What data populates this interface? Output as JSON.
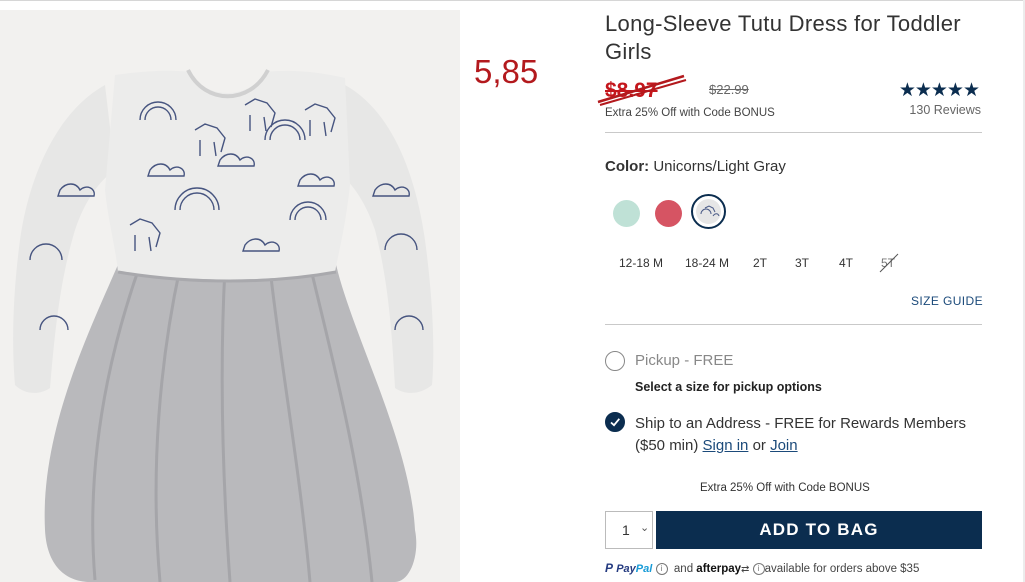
{
  "overlay": {
    "price_annotation": "5,85"
  },
  "product": {
    "title": "Long-Sleeve Tutu Dress for Toddler Girls",
    "sale_price": "$8.97",
    "original_price": "$22.99",
    "promo": "Extra 25% Off with Code BONUS",
    "rating_stars": "★★★★★",
    "rating_value": 5,
    "reviews": "130 Reviews",
    "image_icon": "dress-photo"
  },
  "color": {
    "label": "Color:",
    "selected": "Unicorns/Light Gray",
    "swatches": [
      {
        "name": "mint",
        "color": "#bfe1d6"
      },
      {
        "name": "coral-red",
        "color": "#d65463"
      },
      {
        "name": "unicorns-light-gray",
        "color": "#e6e6e6",
        "selected": true
      }
    ]
  },
  "sizes": [
    "12-18 M",
    "18-24 M",
    "2T",
    "3T",
    "4T",
    "5T"
  ],
  "unavailable_size": "5T",
  "size_guide": "SIZE GUIDE",
  "fulfillment": {
    "pickup_label": "Pickup - FREE",
    "pickup_sub": "Select a size for pickup options",
    "ship_label": "Ship to an Address - FREE for Rewards Members ($50 min)",
    "sign_in": "Sign in",
    "or": "or",
    "join": "Join"
  },
  "promo_bottom": "Extra 25% Off with Code BONUS",
  "quantity": "1",
  "add_to_bag": "ADD TO BAG",
  "payment": {
    "paypal_p": "P",
    "paypal_pay": "Pay",
    "paypal_pal": "Pal",
    "and": "and",
    "afterpay": "afterpay",
    "available": "available for orders above $35"
  },
  "colors": {
    "brand_navy": "#0b2d4f",
    "sale_red": "#c4161c",
    "link_blue": "#1b4a7a"
  }
}
